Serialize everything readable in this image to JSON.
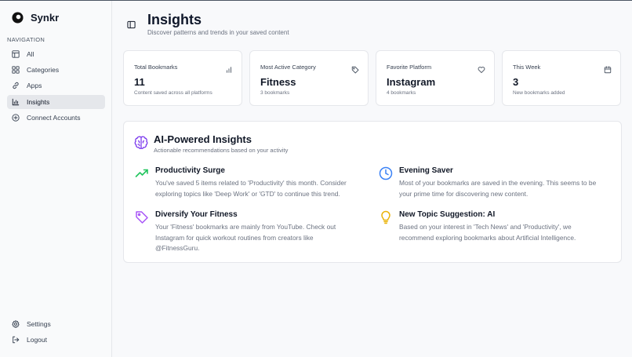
{
  "brand": {
    "name": "Synkr"
  },
  "sidebar": {
    "heading": "Navigation",
    "items": [
      {
        "label": "All",
        "icon": "layout-icon",
        "active": false
      },
      {
        "label": "Categories",
        "icon": "grid-icon",
        "active": false
      },
      {
        "label": "Apps",
        "icon": "link-icon",
        "active": false
      },
      {
        "label": "Insights",
        "icon": "bar-chart-icon",
        "active": true
      },
      {
        "label": "Connect Accounts",
        "icon": "plus-circle-icon",
        "active": false
      }
    ],
    "bottom_items": [
      {
        "label": "Settings",
        "icon": "gear-icon"
      },
      {
        "label": "Logout",
        "icon": "logout-icon"
      }
    ]
  },
  "header": {
    "title": "Insights",
    "subtitle": "Discover patterns and trends in your saved content"
  },
  "stats": [
    {
      "title": "Total Bookmarks",
      "value": "11",
      "description": "Content saved across all platforms",
      "icon": "bar-chart-icon"
    },
    {
      "title": "Most Active Category",
      "value": "Fitness",
      "description": "3 bookmarks",
      "icon": "tag-icon"
    },
    {
      "title": "Favorite Platform",
      "value": "Instagram",
      "description": "4 bookmarks",
      "icon": "heart-icon"
    },
    {
      "title": "This Week",
      "value": "3",
      "description": "New bookmarks added",
      "icon": "calendar-icon"
    }
  ],
  "ai_insights": {
    "title": "AI-Powered Insights",
    "subtitle": "Actionable recommendations based on your activity",
    "icon": "brain-icon",
    "items": [
      {
        "title": "Productivity Surge",
        "text": "You've saved 5 items related to 'Productivity' this month. Consider exploring topics like 'Deep Work' or 'GTD' to continue this trend.",
        "icon": "trending-up-icon",
        "color": "#22c55e"
      },
      {
        "title": "Evening Saver",
        "text": "Most of your bookmarks are saved in the evening. This seems to be your prime time for discovering new content.",
        "icon": "clock-icon",
        "color": "#3b82f6"
      },
      {
        "title": "Diversify Your Fitness",
        "text": "Your 'Fitness' bookmarks are mainly from YouTube. Check out Instagram for quick workout routines from creators like @FitnessGuru.",
        "icon": "tag-icon",
        "color": "#a855f7"
      },
      {
        "title": "New Topic Suggestion: AI",
        "text": "Based on your interest in 'Tech News' and 'Productivity', we recommend exploring bookmarks about Artificial Intelligence.",
        "icon": "lightbulb-icon",
        "color": "#eab308"
      }
    ]
  },
  "colors": {
    "accent_purple": "#7c3aed",
    "green": "#22c55e",
    "blue": "#3b82f6",
    "purple": "#a855f7",
    "yellow": "#eab308"
  }
}
